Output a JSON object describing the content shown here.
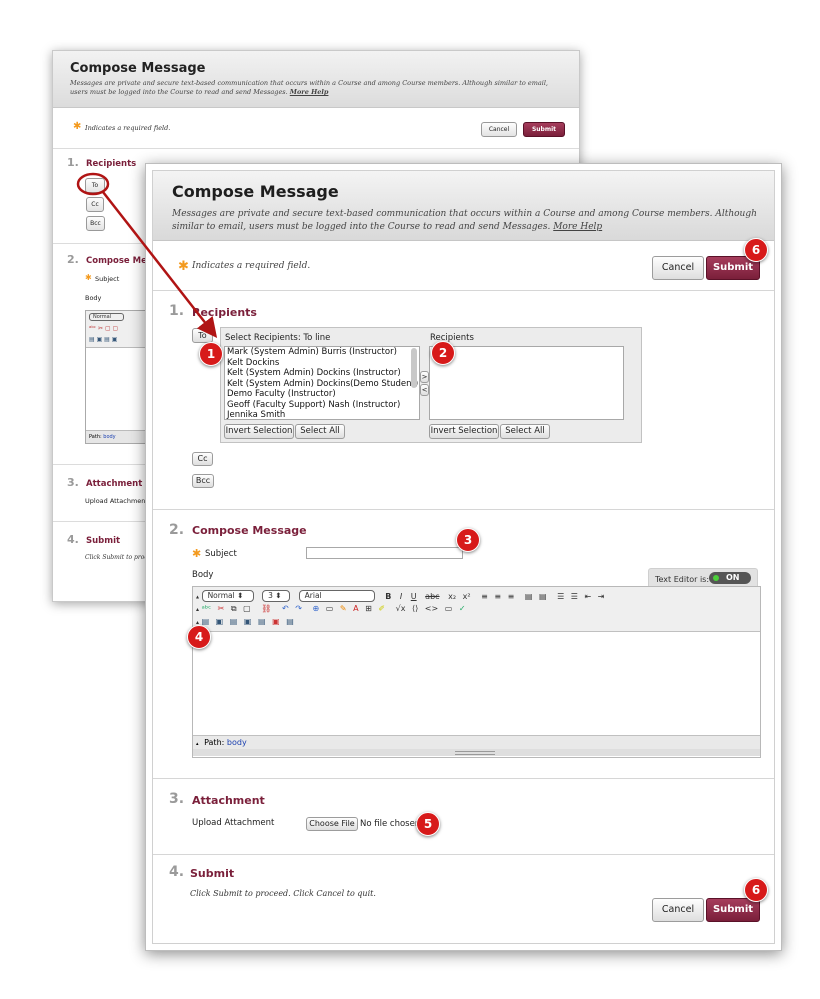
{
  "back": {
    "title": "Compose Message",
    "description": "Messages are private and secure text-based communication that occurs within a Course and among Course members. Although similar to email, users must be logged into the Course to read and send Messages.",
    "more_help": "More Help",
    "required_note": "Indicates a required field.",
    "cancel_label": "Cancel",
    "submit_label": "Submit",
    "sections": [
      {
        "num": "1.",
        "title": "Recipients"
      },
      {
        "num": "2.",
        "title": "Compose Mess"
      },
      {
        "num": "3.",
        "title": "Attachment"
      },
      {
        "num": "4.",
        "title": "Submit"
      }
    ],
    "to_label": "To",
    "cc_label": "Cc",
    "bcc_label": "Bcc",
    "subject_label": "Subject",
    "body_label": "Body",
    "style_select": "Normal",
    "path_label": "Path:",
    "path_value": "body",
    "upload_label": "Upload Attachment",
    "submit_hint": "Click Submit to procee"
  },
  "front": {
    "title": "Compose Message",
    "description": "Messages are private and secure text-based communication that occurs within a Course and among Course members. Although similar to email, users must be logged into the Course to read and send Messages.",
    "more_help": "More Help",
    "required_note": "Indicates a required field.",
    "cancel_label": "Cancel",
    "submit_label": "Submit",
    "recipients": {
      "num": "1.",
      "title": "Recipients",
      "to_label": "To",
      "cc_label": "Cc",
      "bcc_label": "Bcc",
      "select_heading": "Select Recipients: To line",
      "recipients_heading": "Recipients",
      "available": [
        "Mark (System Admin) Burris (Instructor)",
        "Kelt Dockins",
        "Kelt (System Admin) Dockins (Instructor)",
        "Kelt (System Admin) Dockins(Demo Student)",
        "Demo Faculty (Instructor)",
        "Geoff (Faculty Support) Nash (Instructor)",
        "Jennika Smith"
      ],
      "move_right": ">",
      "move_left": "<",
      "invert_label": "Invert Selection",
      "select_all_label": "Select All"
    },
    "compose": {
      "num": "2.",
      "title": "Compose Message",
      "subject_label": "Subject",
      "body_label": "Body",
      "text_editor_label": "Text Editor is:",
      "toggle_label": "ON",
      "style_select": "Normal",
      "size_select": "3",
      "font_select": "Arial",
      "path_label": "Path:",
      "path_value": "body"
    },
    "attachment": {
      "num": "3.",
      "title": "Attachment",
      "upload_label": "Upload Attachment",
      "choose_file": "Choose File",
      "no_file": "No file chosen"
    },
    "submit_section": {
      "num": "4.",
      "title": "Submit",
      "hint": "Click Submit to proceed. Click Cancel to quit."
    }
  },
  "badges": [
    "1",
    "2",
    "3",
    "4",
    "5",
    "6",
    "6"
  ],
  "colors": {
    "accent": "#7a1f3a",
    "badge": "#d71a1a",
    "required": "#f39a1f",
    "link": "#1a3fb0"
  }
}
